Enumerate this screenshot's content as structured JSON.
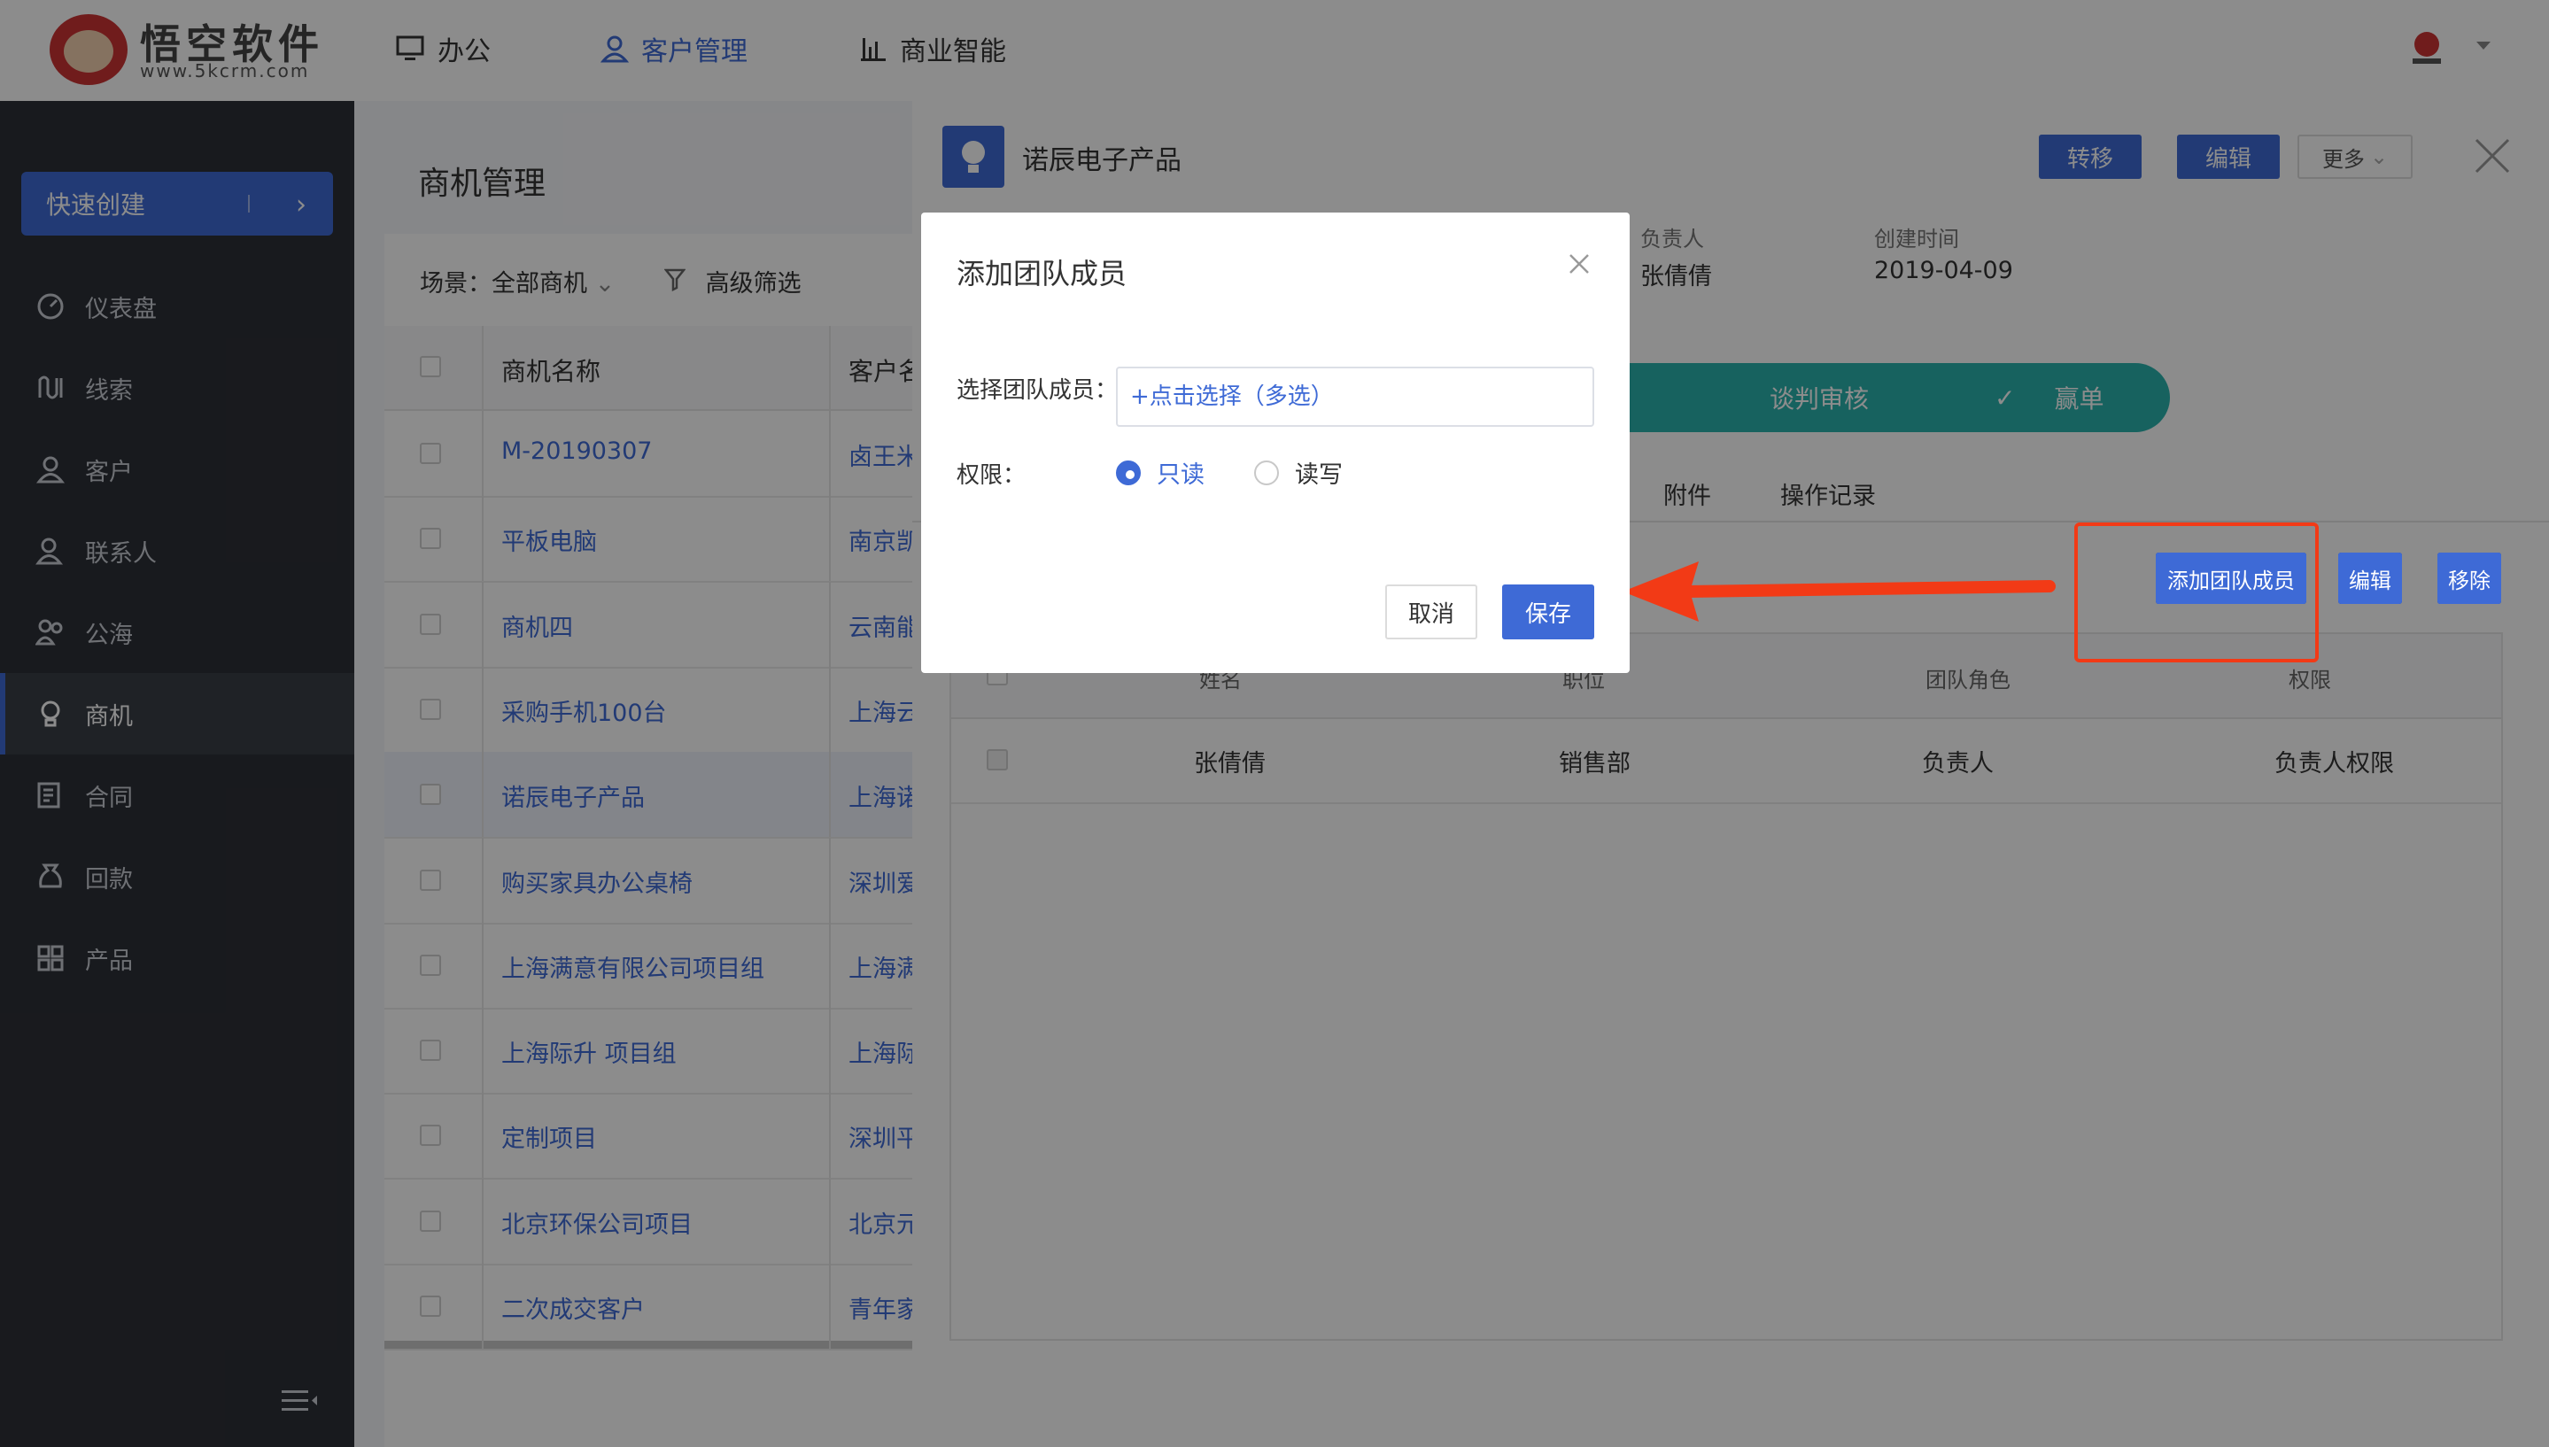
{
  "header": {
    "logo_title": "悟空软件",
    "logo_sub": "www.5kcrm.com",
    "nav": [
      {
        "label": "办公",
        "icon": "monitor-icon"
      },
      {
        "label": "客户管理",
        "icon": "user-icon"
      },
      {
        "label": "商业智能",
        "icon": "bar-chart-icon"
      }
    ]
  },
  "sidebar": {
    "quick_create": "快速创建",
    "items": [
      {
        "label": "仪表盘",
        "icon": "dashboard-icon"
      },
      {
        "label": "线索",
        "icon": "clue-icon"
      },
      {
        "label": "客户",
        "icon": "customer-icon"
      },
      {
        "label": "联系人",
        "icon": "contact-icon"
      },
      {
        "label": "公海",
        "icon": "pool-icon"
      },
      {
        "label": "商机",
        "icon": "bulb-icon"
      },
      {
        "label": "合同",
        "icon": "contract-icon"
      },
      {
        "label": "回款",
        "icon": "money-bag-icon"
      },
      {
        "label": "产品",
        "icon": "product-icon"
      }
    ]
  },
  "list": {
    "title": "商机管理",
    "scene": "场景：全部商机",
    "filter": "高级筛选",
    "columns": [
      "商机名称",
      "客户名称"
    ],
    "rows": [
      {
        "name": "M-20190307",
        "customer": "卤王米"
      },
      {
        "name": "平板电脑",
        "customer": "南京凯"
      },
      {
        "name": "商机四",
        "customer": "云南能"
      },
      {
        "name": "采购手机100台",
        "customer": "上海云"
      },
      {
        "name": "诺辰电子产品",
        "customer": "上海诺"
      },
      {
        "name": "购买家具办公桌椅",
        "customer": "深圳爱"
      },
      {
        "name": "上海满意有限公司项目组",
        "customer": "上海满"
      },
      {
        "name": "上海际升 项目组",
        "customer": "上海际"
      },
      {
        "name": "定制项目",
        "customer": "深圳平"
      },
      {
        "name": "北京环保公司项目",
        "customer": "北京元"
      },
      {
        "name": "二次成交客户",
        "customer": "青年家"
      }
    ]
  },
  "detail": {
    "title": "诺辰电子产品",
    "buttons": {
      "transfer": "转移",
      "edit": "编辑",
      "more": "更多"
    },
    "owner_label": "负责人",
    "owner_value": "张倩倩",
    "created_label": "创建时间",
    "created_value": "2019-04-09",
    "stages": [
      "谈判审核",
      "赢单"
    ],
    "tabs": [
      "附件",
      "操作记录"
    ],
    "team_buttons": {
      "add": "添加团队成员",
      "edit": "编辑",
      "remove": "移除"
    },
    "team_columns": [
      "姓名",
      "职位",
      "团队角色",
      "权限"
    ],
    "team_rows": [
      {
        "name": "张倩倩",
        "position": "销售部",
        "role": "负责人",
        "permission": "负责人权限"
      }
    ]
  },
  "dialog": {
    "title": "添加团队成员",
    "member_label": "选择团队成员：",
    "member_placeholder": "+点击选择（多选）",
    "permission_label": "权限：",
    "options": [
      "只读",
      "读写"
    ],
    "selected_option": "只读",
    "cancel": "取消",
    "save": "保存"
  },
  "colors": {
    "primary": "#3e6ad6",
    "sidebar": "#2d3037",
    "stage": "#2bb3ad",
    "annotation": "#f23a16"
  }
}
